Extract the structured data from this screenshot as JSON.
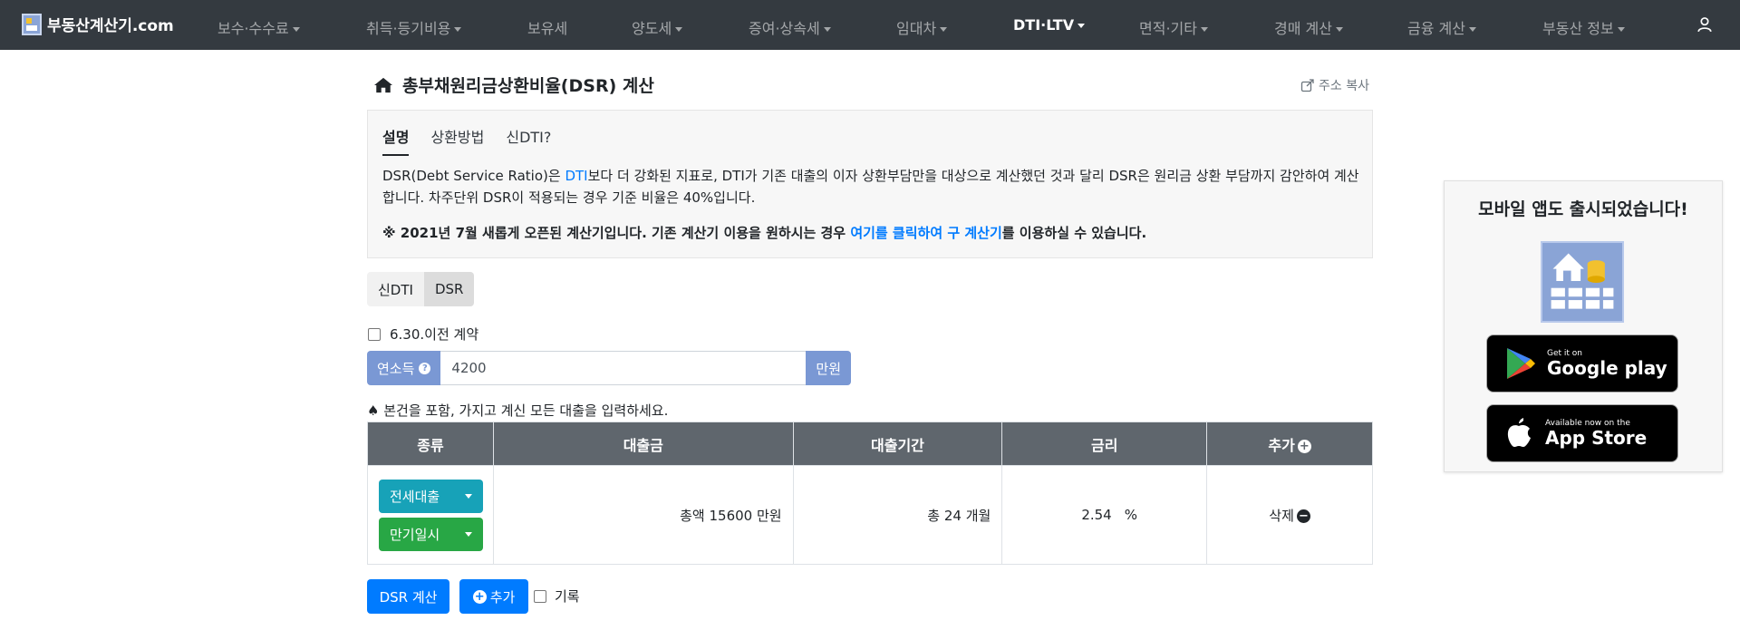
{
  "navbar": {
    "brand": "부동산계산기.com",
    "items": [
      {
        "label": "보수·수수료",
        "dropdown": true
      },
      {
        "label": "취득·등기비용",
        "dropdown": true
      },
      {
        "label": "보유세",
        "dropdown": false
      },
      {
        "label": "양도세",
        "dropdown": true
      },
      {
        "label": "증여·상속세",
        "dropdown": true
      },
      {
        "label": "임대차",
        "dropdown": true
      },
      {
        "label": "DTI·LTV",
        "dropdown": true,
        "active": true
      },
      {
        "label": "면적·기타",
        "dropdown": true
      },
      {
        "label": "경매 계산",
        "dropdown": true
      },
      {
        "label": "금융 계산",
        "dropdown": true
      },
      {
        "label": "부동산 정보",
        "dropdown": true
      }
    ]
  },
  "page": {
    "title": "총부채원리금상환비율(DSR) 계산",
    "copy_link": "주소 복사"
  },
  "info": {
    "tabs": [
      "설명",
      "상환방법",
      "신DTI?"
    ],
    "text_before": "DSR(Debt Service Ratio)은 ",
    "text_link": "DTI",
    "text_after": "보다 더 강화된 지표로, DTI가 기존 대출의 이자 상환부담만을 대상으로 계산했던 것과 달리 DSR은 원리금 상환 부담까지 감안하여 계산합니다. 차주단위 DSR이 적용되는 경우 기준 비율은 40%입니다.",
    "notice_before": "※ 2021년 7월 새롭게 오픈된 계산기입니다. 기존 계산기 이용을 원하시는 경우 ",
    "notice_link": "여기를 클릭하여 구 계산기",
    "notice_after": "를 이용하실 수 있습니다."
  },
  "toggle": {
    "sindti": "신DTI",
    "dsr": "DSR"
  },
  "contract_checkbox": "6.30.이전 계약",
  "income": {
    "label": "연소득",
    "help": "?",
    "value": "4200",
    "unit": "만원"
  },
  "instruction": "♠ 본건을 포함, 가지고 계신 모든 대출을 입력하세요.",
  "table": {
    "headers": [
      "종류",
      "대출금",
      "대출기간",
      "금리",
      "추가"
    ],
    "rows": [
      {
        "type1": "전세대출",
        "type2": "만기일시",
        "amount": "총액 15600 만원",
        "period": "총 24 개월",
        "rate": "2.54",
        "rate_unit": "%",
        "delete": "삭제"
      }
    ]
  },
  "actions": {
    "calc": "DSR 계산",
    "add": "추가",
    "record": "기록"
  },
  "sidebar": {
    "title": "모바일 앱도 출시되었습니다!",
    "google_small": "Get it on",
    "google_big": "Google play",
    "apple_small": "Available now on the",
    "apple_big": "App Store"
  }
}
